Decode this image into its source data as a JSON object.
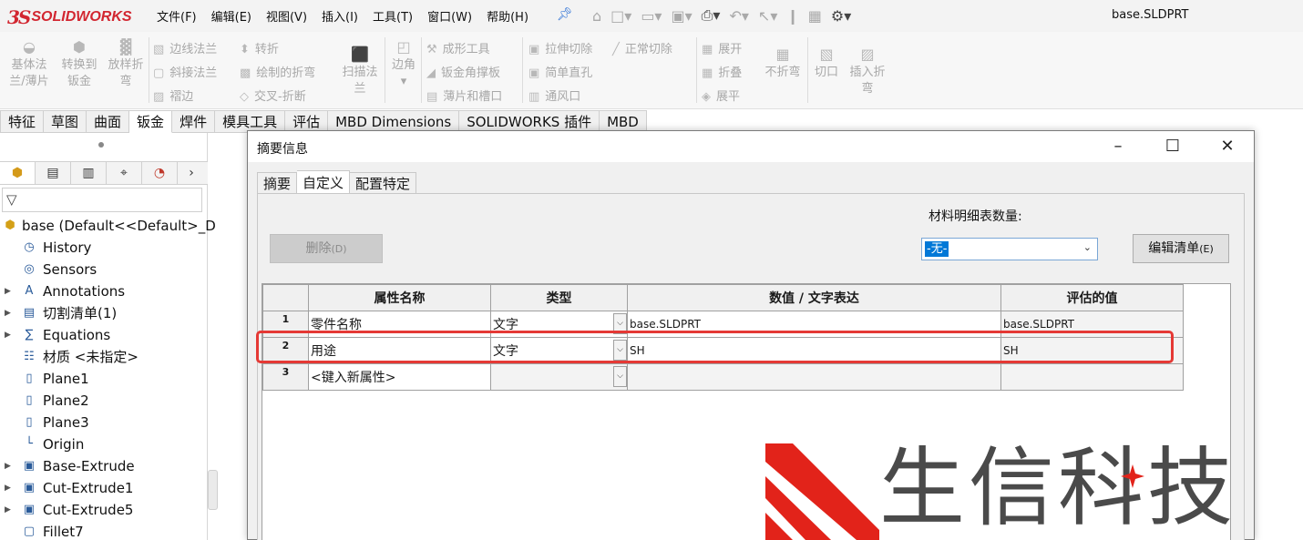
{
  "app": {
    "logo_mark": "3S",
    "logo_text": "SOLIDWORKS",
    "menus": [
      "文件(F)",
      "编辑(E)",
      "视图(V)",
      "插入(I)",
      "工具(T)",
      "窗口(W)",
      "帮助(H)"
    ],
    "document_title": "base.SLDPRT"
  },
  "ribbon": {
    "base_flange": [
      "基体法",
      "兰/薄片"
    ],
    "convert": [
      "转换到",
      "钣金"
    ],
    "lofted": [
      "放样折",
      "弯"
    ],
    "edge_flange": "边线法兰",
    "miter_flange": "斜接法兰",
    "hem": "褶边",
    "jog": "转折",
    "sketched_bend": "绘制的折弯",
    "cross_break": "交叉-折断",
    "swept_flange": [
      "扫描法",
      "兰"
    ],
    "corners": "边角",
    "forming_tool": "成形工具",
    "gusset": "钣金角撑板",
    "tab_slot": "薄片和槽口",
    "extruded_cut": "拉伸切除",
    "simple_hole": "简单直孔",
    "vent": "通风口",
    "normal_cut": "正常切除",
    "unfold": "展开",
    "fold": "折叠",
    "flatten": "展平",
    "no_bends": "不折弯",
    "rip": "切口",
    "insert_bends": [
      "插入折",
      "弯"
    ]
  },
  "command_tabs": [
    "特征",
    "草图",
    "曲面",
    "钣金",
    "焊件",
    "模具工具",
    "评估",
    "MBD Dimensions",
    "SOLIDWORKS 插件",
    "MBD"
  ],
  "command_tab_active": 3,
  "feature_tree": {
    "root": "base  (Default<<Default>_D",
    "items": [
      {
        "label": "History",
        "icon": "history-icon",
        "arrow": false
      },
      {
        "label": "Sensors",
        "icon": "sensor-icon",
        "arrow": false
      },
      {
        "label": "Annotations",
        "icon": "annotation-icon",
        "arrow": true
      },
      {
        "label": "切割清单(1)",
        "icon": "cut-list-icon",
        "arrow": true
      },
      {
        "label": "Equations",
        "icon": "equation-icon",
        "arrow": true
      },
      {
        "label": "材质 <未指定>",
        "icon": "material-icon",
        "arrow": false
      },
      {
        "label": "Plane1",
        "icon": "plane-icon",
        "arrow": false
      },
      {
        "label": "Plane2",
        "icon": "plane-icon",
        "arrow": false
      },
      {
        "label": "Plane3",
        "icon": "plane-icon",
        "arrow": false
      },
      {
        "label": "Origin",
        "icon": "origin-icon",
        "arrow": false
      },
      {
        "label": "Base-Extrude",
        "icon": "extrude-icon",
        "arrow": true
      },
      {
        "label": "Cut-Extrude1",
        "icon": "cut-extrude-icon",
        "arrow": true
      },
      {
        "label": "Cut-Extrude5",
        "icon": "cut-extrude-icon",
        "arrow": true
      },
      {
        "label": "Fillet7",
        "icon": "fillet-icon",
        "arrow": false
      }
    ]
  },
  "dialog": {
    "title": "摘要信息",
    "tabs": [
      "摘要",
      "自定义",
      "配置特定"
    ],
    "active_tab": 1,
    "bom_label": "材料明细表数量:",
    "bom_value": "-无-",
    "delete_button": "删除",
    "delete_key": "(D)",
    "edit_list_button": "编辑清单",
    "edit_list_key": "(E)",
    "columns": [
      "",
      "属性名称",
      "类型",
      "数值 / 文字表达",
      "评估的值"
    ],
    "rows": [
      {
        "num": "1",
        "name": "零件名称",
        "type": "文字",
        "value": "base.SLDPRT",
        "evaluated": "base.SLDPRT"
      },
      {
        "num": "2",
        "name": "用途",
        "type": "文字",
        "value": "SH",
        "evaluated": "SH"
      },
      {
        "num": "3",
        "name": "<键入新属性>",
        "type": "",
        "value": "",
        "evaluated": ""
      }
    ]
  },
  "watermark": {
    "text": "生信科技",
    "accent_color": "#e2231a"
  }
}
